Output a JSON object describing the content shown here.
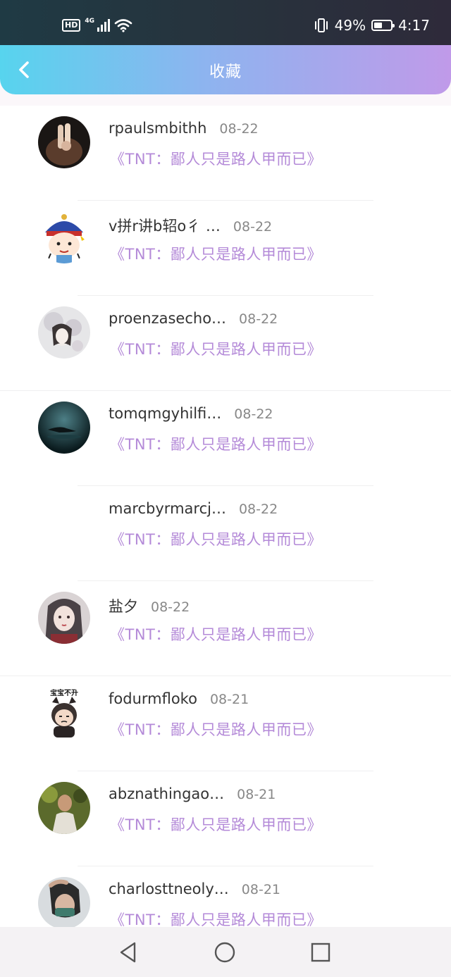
{
  "status_bar": {
    "hd": "HD",
    "network": "4G",
    "battery_percent": "49%",
    "time": "4:17",
    "battery_level": 0.49
  },
  "header": {
    "title": "收藏",
    "back_icon": "chevron-left-icon"
  },
  "favorites": [
    {
      "username": "rpaulsmbithh",
      "date": "08-22",
      "book": "《TNT：鄙人只是路人甲而已》",
      "avatar": "photo"
    },
    {
      "username": "v拼r讲b轺o彳 …",
      "date": "08-22",
      "book": "《TNT：鄙人只是路人甲而已》",
      "avatar": "cartoon"
    },
    {
      "username": "proenzasecho…",
      "date": "08-22",
      "book": "《TNT：鄙人只是路人甲而已》",
      "avatar": "photo"
    },
    {
      "username": "tomqmgyhilfi…",
      "date": "08-22",
      "book": "《TNT：鄙人只是路人甲而已》",
      "avatar": "photo"
    },
    {
      "username": "marcbyrmarcj…",
      "date": "08-22",
      "book": "《TNT：鄙人只是路人甲而已》",
      "avatar": "none"
    },
    {
      "username": "盐夕",
      "date": "08-22",
      "book": "《TNT：鄙人只是路人甲而已》",
      "avatar": "photo"
    },
    {
      "username": "fodurmfloko",
      "date": "08-21",
      "book": "《TNT：鄙人只是路人甲而已》",
      "avatar": "cartoon"
    },
    {
      "username": "abznathingao…",
      "date": "08-21",
      "book": "《TNT：鄙人只是路人甲而已》",
      "avatar": "photo"
    },
    {
      "username": "charlosttneoly…",
      "date": "08-21",
      "book": "《TNT：鄙人只是路人甲而已》",
      "avatar": "photo"
    }
  ],
  "avatar_sticker_text": "宝宝不开",
  "nav_bar": {
    "back_icon": "triangle-back-icon",
    "home_icon": "circle-home-icon",
    "recents_icon": "square-recents-icon"
  },
  "colors": {
    "header_gradient_start": "#57d4ee",
    "header_gradient_end": "#c09ae9",
    "book_title": "#b48ad8"
  }
}
